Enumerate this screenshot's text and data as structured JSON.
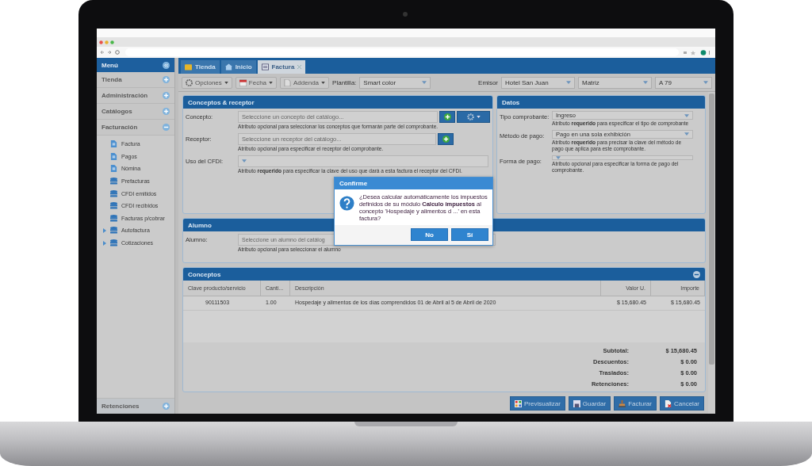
{
  "sidebar": {
    "title": "Menú",
    "sections": [
      {
        "label": "Tienda",
        "expanded": false
      },
      {
        "label": "Administración",
        "expanded": false
      },
      {
        "label": "Catálogos",
        "expanded": false
      },
      {
        "label": "Facturación",
        "expanded": true,
        "children": [
          {
            "label": "Factura",
            "kind": "document",
            "collapsed": false
          },
          {
            "label": "Pagos",
            "kind": "document",
            "collapsed": false
          },
          {
            "label": "Nómina",
            "kind": "document",
            "collapsed": false
          },
          {
            "label": "Prefacturas",
            "kind": "database",
            "collapsed": false
          },
          {
            "label": "CFDI emitidos",
            "kind": "database",
            "collapsed": false
          },
          {
            "label": "CFDI recibidos",
            "kind": "database",
            "collapsed": false
          },
          {
            "label": "Facturas p/cobrar",
            "kind": "database",
            "collapsed": false
          },
          {
            "label": "Autofactura",
            "kind": "database",
            "collapsed": true
          },
          {
            "label": "Cotizaciones",
            "kind": "database",
            "collapsed": true
          }
        ]
      }
    ],
    "footer": {
      "label": "Retenciones",
      "expanded": false
    }
  },
  "tabs": [
    {
      "label": "Tienda",
      "kind": "store",
      "selected": false,
      "closable": false
    },
    {
      "label": "Inicio",
      "kind": "home",
      "selected": false,
      "closable": false
    },
    {
      "label": "Factura",
      "kind": "form",
      "selected": true,
      "closable": true
    }
  ],
  "toolbar": {
    "buttons": [
      {
        "label": "Opciones",
        "kind": "gear"
      },
      {
        "label": "Fecha",
        "kind": "calendar"
      },
      {
        "label": "Addenda",
        "kind": "page"
      }
    ],
    "plantilla": {
      "label": "Plantilla:",
      "value": "Smart color"
    },
    "emisor": {
      "label": "Emisor",
      "value": "Hotel San Juan"
    },
    "sucursal": {
      "value": "Matriz"
    },
    "serie": {
      "value": "A 79"
    }
  },
  "conceptos_receptor": {
    "title": "Conceptos & receptor",
    "fields": [
      {
        "label": "Concepto:",
        "placeholder": "Seleccione un concepto del catálogo...",
        "hint": "Atributo opcional para seleccionar los conceptos que formarán parte del comprobante.",
        "kind": "add_gear"
      },
      {
        "label": "Receptor:",
        "placeholder": "Seleccione un receptor del catálogo...",
        "hint": "Atributo opcional para especificar el receptor del comprobante.",
        "kind": "add"
      },
      {
        "label": "Uso del CFDI:",
        "hint": "Atributo **requerido** para especificar la clave del uso que dará a esta factura el receptor del CFDI.",
        "kind": "select"
      }
    ]
  },
  "datos": {
    "title": "Datos",
    "fields": [
      {
        "label": "Tipo comprobante:",
        "value": "Ingreso",
        "hint": "Atributo **requerido** para especificar el tipo de comprobante"
      },
      {
        "label": "Método de pago:",
        "value": "Pago en una sola exhibición",
        "hint": "Atributo **requerido** para precisar la clave del método de pago que aplica para este comprobante."
      },
      {
        "label": "Forma de pago:",
        "hint": "Atributo opcional para especificar la forma de pago del comprobante."
      }
    ]
  },
  "alumno": {
    "title": "Alumno",
    "label": "Alumno:",
    "placeholder": "Seleccione un alumno del catálog",
    "hint": "Atributo opcional para seleccionar el alumno"
  },
  "conceptos": {
    "title": "Conceptos",
    "collapsible": true,
    "columns": [
      "Clave producto/servicio",
      "Canti...",
      "Descripción",
      "Valor U.",
      "Importe"
    ],
    "rows": [
      [
        "90111503",
        "1.00",
        "Hospedaje y alimentos de los días comprendidos 01 de Abril al 5 de Abril de 2020",
        "$ 15,680.45",
        "$ 15,680.45"
      ]
    ],
    "totals": [
      {
        "label": "Subtotal:",
        "value": "$ 15,680.45"
      },
      {
        "label": "Descuentos:",
        "value": "$ 0.00"
      },
      {
        "label": "Traslados:",
        "value": "$ 0.00"
      },
      {
        "label": "Retenciones:",
        "value": "$ 0.00"
      }
    ]
  },
  "actions": [
    {
      "label": "Previsualizar",
      "kind": "preview"
    },
    {
      "label": "Guardar",
      "kind": "save"
    },
    {
      "label": "Facturar",
      "kind": "stamp"
    },
    {
      "label": "Cancelar",
      "kind": "cancel"
    }
  ],
  "dialog": {
    "title": "Confirme",
    "message": "¿Desea calcular automáticamente los impuestos definidos de su módulo **Calculo impuestos** al concepto 'Hospedaje y alimentos d ...' en esta factura?",
    "buttons": [
      "No",
      "Sí"
    ]
  }
}
